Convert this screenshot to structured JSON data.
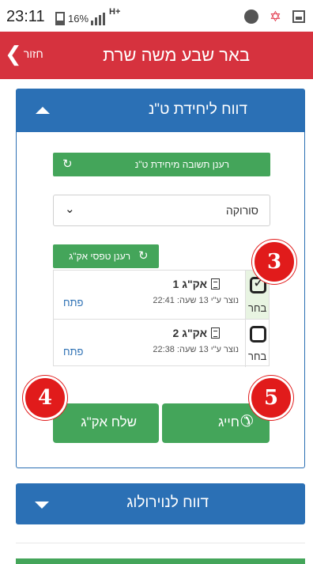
{
  "status_bar": {
    "time": "23:11",
    "battery_percent": "16%",
    "network": "H+",
    "icons": [
      "battery-icon",
      "signal-icon",
      "alarm-icon",
      "star-icon",
      "image-icon"
    ]
  },
  "header": {
    "title": "באר שבע משה שרת",
    "back_label": "חזור",
    "back_icon": "chevron-left-icon",
    "background_color": "#d6323e"
  },
  "section_tan": {
    "title": "דווח ליחידת ט\"נ",
    "expanded": true,
    "refresh_response_label": "רענן תשובה מיחידת ט\"נ",
    "hospital_select": {
      "selected": "סורוקה"
    },
    "refresh_forms_label": "רענן טפסי אק\"ג",
    "forms": [
      {
        "name": "אק\"ג 1",
        "meta": "נוצר ע\"י 13 שעה: 22:41",
        "select_label": "בחר",
        "open_label": "פתח",
        "checked": true
      },
      {
        "name": "אק\"ג 2",
        "meta": "נוצר ע\"י 13 שעה: 22:38",
        "select_label": "בחר",
        "open_label": "פתח",
        "checked": false
      }
    ],
    "send_label": "שלח אק\"ג",
    "call_label": "חייג",
    "accent_color": "#2b70b5",
    "button_color": "#44a55a"
  },
  "badges": {
    "b3": "3",
    "b4": "4",
    "b5": "5",
    "color": "#e11b1b"
  },
  "section_neuro": {
    "title": "דווח לנוירולוג",
    "expanded": false
  }
}
